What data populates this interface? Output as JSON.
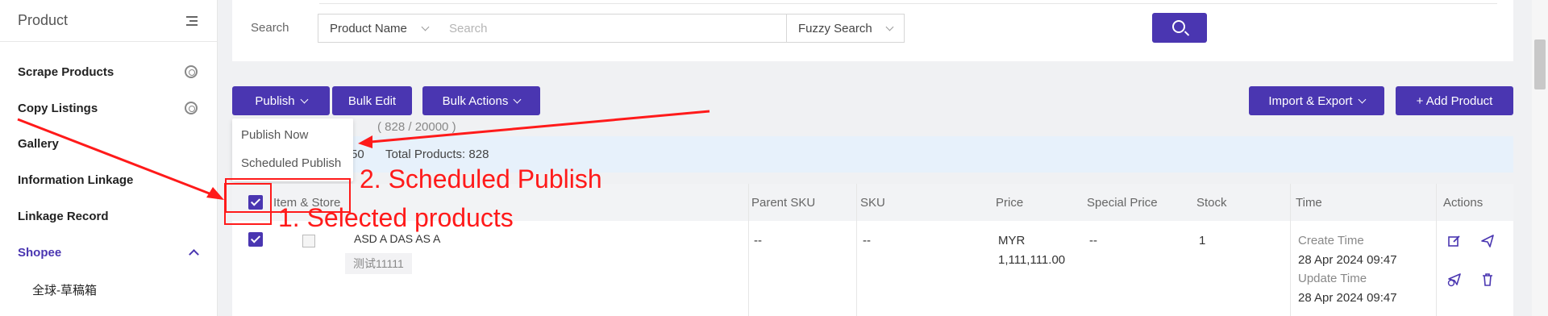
{
  "sidebar": {
    "title": "Product",
    "items": [
      {
        "label": "Scrape Products"
      },
      {
        "label": "Copy Listings"
      },
      {
        "label": "Gallery"
      },
      {
        "label": "Information Linkage"
      },
      {
        "label": "Linkage Record"
      },
      {
        "label": "Shopee"
      }
    ],
    "subitem": "全球-草稿箱"
  },
  "search": {
    "label": "Search",
    "field_select": "Product Name",
    "placeholder": "Search",
    "mode_select": "Fuzzy Search"
  },
  "toolbar": {
    "publish": "Publish",
    "bulk_edit": "Bulk Edit",
    "bulk_actions": "Bulk Actions",
    "import_export": "Import & Export",
    "add_product": "+ Add Product"
  },
  "publish_menu": [
    "Publish Now",
    "Scheduled Publish"
  ],
  "counter": "( 828 / 20000 )",
  "selection_fragment": "50",
  "total_products": "Total Products: 828",
  "table": {
    "headers": [
      "Item & Store",
      "Parent SKU",
      "SKU",
      "Price",
      "Special Price",
      "Stock",
      "Time",
      "Actions"
    ],
    "row": {
      "title": "ASD A DAS AS A",
      "store": "测试11111",
      "parent_sku": "--",
      "sku": "--",
      "price_currency": "MYR",
      "price_value": "1,111,111.00",
      "special_price": "--",
      "stock": "1",
      "create_label": "Create Time",
      "create_time": "28 Apr 2024 09:47",
      "update_label": "Update Time",
      "update_time": "28 Apr 2024 09:47"
    }
  },
  "annotations": {
    "step1": "1. Selected products",
    "step2": "2. Scheduled Publish"
  },
  "colors": {
    "accent": "#4a36b1",
    "annotation": "#ff1a1a"
  }
}
